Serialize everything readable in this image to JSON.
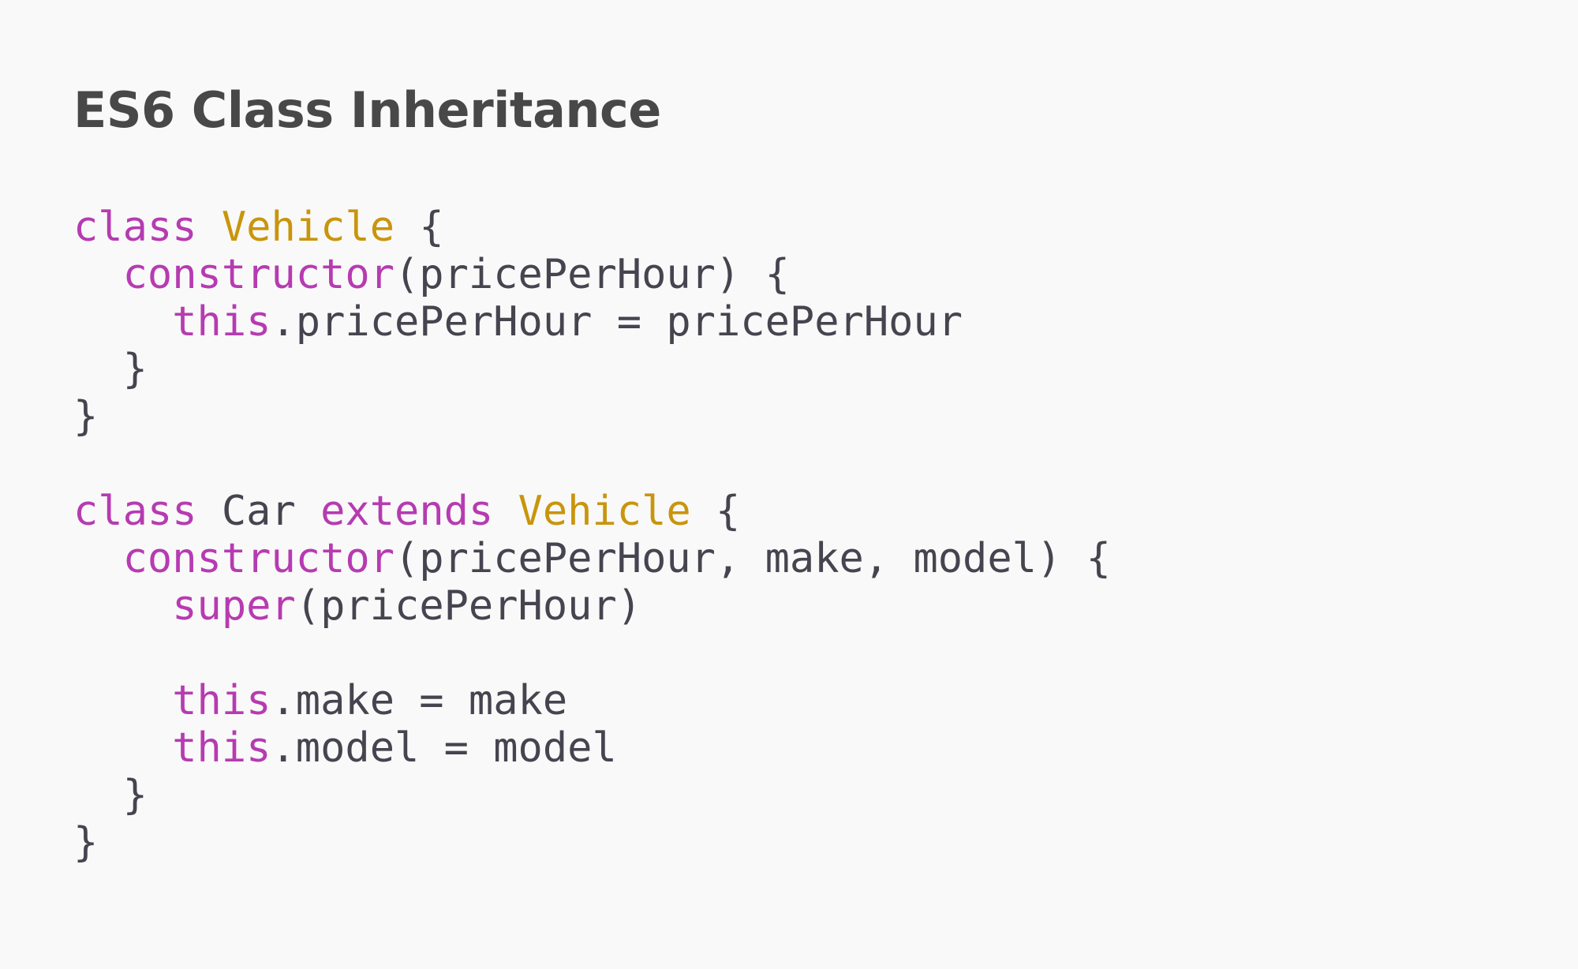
{
  "slide": {
    "title": "ES6 Class Inheritance"
  },
  "code": {
    "language": "javascript",
    "colors": {
      "keyword": "#b63bb1",
      "class_name": "#c9950c",
      "text": "#45444f",
      "title": "#484848",
      "background": "#f9f9f9"
    },
    "lines": [
      [
        {
          "t": "class",
          "k": "kw"
        },
        {
          "t": " ",
          "k": "txt"
        },
        {
          "t": "Vehicle",
          "k": "cls"
        },
        {
          "t": " {",
          "k": "txt"
        }
      ],
      [
        {
          "t": "  ",
          "k": "txt"
        },
        {
          "t": "constructor",
          "k": "kw"
        },
        {
          "t": "(pricePerHour) {",
          "k": "txt"
        }
      ],
      [
        {
          "t": "    ",
          "k": "txt"
        },
        {
          "t": "this",
          "k": "kw"
        },
        {
          "t": ".pricePerHour = pricePerHour",
          "k": "txt"
        }
      ],
      [
        {
          "t": "  }",
          "k": "txt"
        }
      ],
      [
        {
          "t": "}",
          "k": "txt"
        }
      ],
      [],
      [
        {
          "t": "class",
          "k": "kw"
        },
        {
          "t": " Car ",
          "k": "txt"
        },
        {
          "t": "extends",
          "k": "kw"
        },
        {
          "t": " ",
          "k": "txt"
        },
        {
          "t": "Vehicle",
          "k": "cls"
        },
        {
          "t": " {",
          "k": "txt"
        }
      ],
      [
        {
          "t": "  ",
          "k": "txt"
        },
        {
          "t": "constructor",
          "k": "kw"
        },
        {
          "t": "(pricePerHour, make, model) {",
          "k": "txt"
        }
      ],
      [
        {
          "t": "    ",
          "k": "txt"
        },
        {
          "t": "super",
          "k": "kw"
        },
        {
          "t": "(pricePerHour)",
          "k": "txt"
        }
      ],
      [],
      [
        {
          "t": "    ",
          "k": "txt"
        },
        {
          "t": "this",
          "k": "kw"
        },
        {
          "t": ".make = make",
          "k": "txt"
        }
      ],
      [
        {
          "t": "    ",
          "k": "txt"
        },
        {
          "t": "this",
          "k": "kw"
        },
        {
          "t": ".model = model",
          "k": "txt"
        }
      ],
      [
        {
          "t": "  }",
          "k": "txt"
        }
      ],
      [
        {
          "t": "}",
          "k": "txt"
        }
      ]
    ]
  }
}
